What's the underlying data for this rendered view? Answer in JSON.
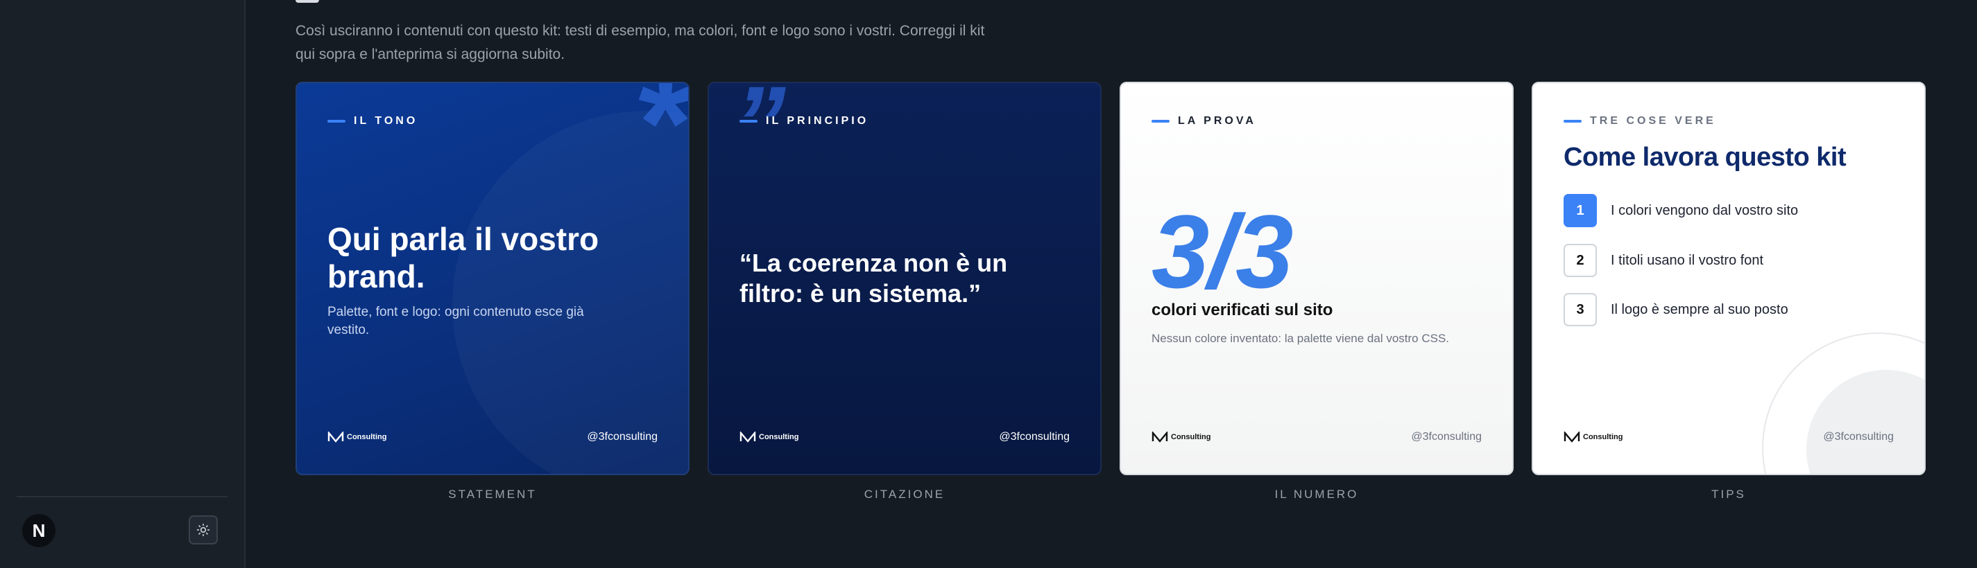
{
  "sidebar": {
    "avatar_letter": "N",
    "theme_toggle_icon": "sun-icon"
  },
  "main": {
    "intro": "Così usciranno i contenuti con questo kit: testi di esempio, ma colori, font e logo sono i vostri. Correggi il kit qui sopra e l'anteprima si aggiorna subito."
  },
  "cards": {
    "statement": {
      "eyebrow": "IL TONO",
      "glyph": "*",
      "title": "Qui parla il vostro brand.",
      "subtitle": "Palette, font e logo: ogni contenuto esce già vestito.",
      "logo_text": "Consulting",
      "handle": "@3fconsulting",
      "label": "STATEMENT"
    },
    "quote": {
      "eyebrow": "IL PRINCIPIO",
      "glyph": "”",
      "quote": "“La coerenza non è un filtro: è un sistema.”",
      "logo_text": "Consulting",
      "handle": "@3fconsulting",
      "label": "CITAZIONE"
    },
    "number": {
      "eyebrow": "LA PROVA",
      "big_number": "3/3",
      "title": "colori verificati sul sito",
      "subtitle": "Nessun colore inventato: la palette viene dal vostro CSS.",
      "logo_text": "Consulting",
      "handle": "@3fconsulting",
      "label": "IL NUMERO"
    },
    "tips": {
      "eyebrow": "TRE COSE VERE",
      "title": "Come lavora questo kit",
      "items": [
        {
          "num": "1",
          "text": "I colori vengono dal vostro sito"
        },
        {
          "num": "2",
          "text": "I titoli usano il vostro font"
        },
        {
          "num": "3",
          "text": "Il logo è sempre al suo posto"
        }
      ],
      "logo_text": "Consulting",
      "handle": "@3fconsulting",
      "label": "TIPS"
    }
  },
  "colors": {
    "accent": "#3b82f6",
    "navy": "#0f2a6b"
  }
}
